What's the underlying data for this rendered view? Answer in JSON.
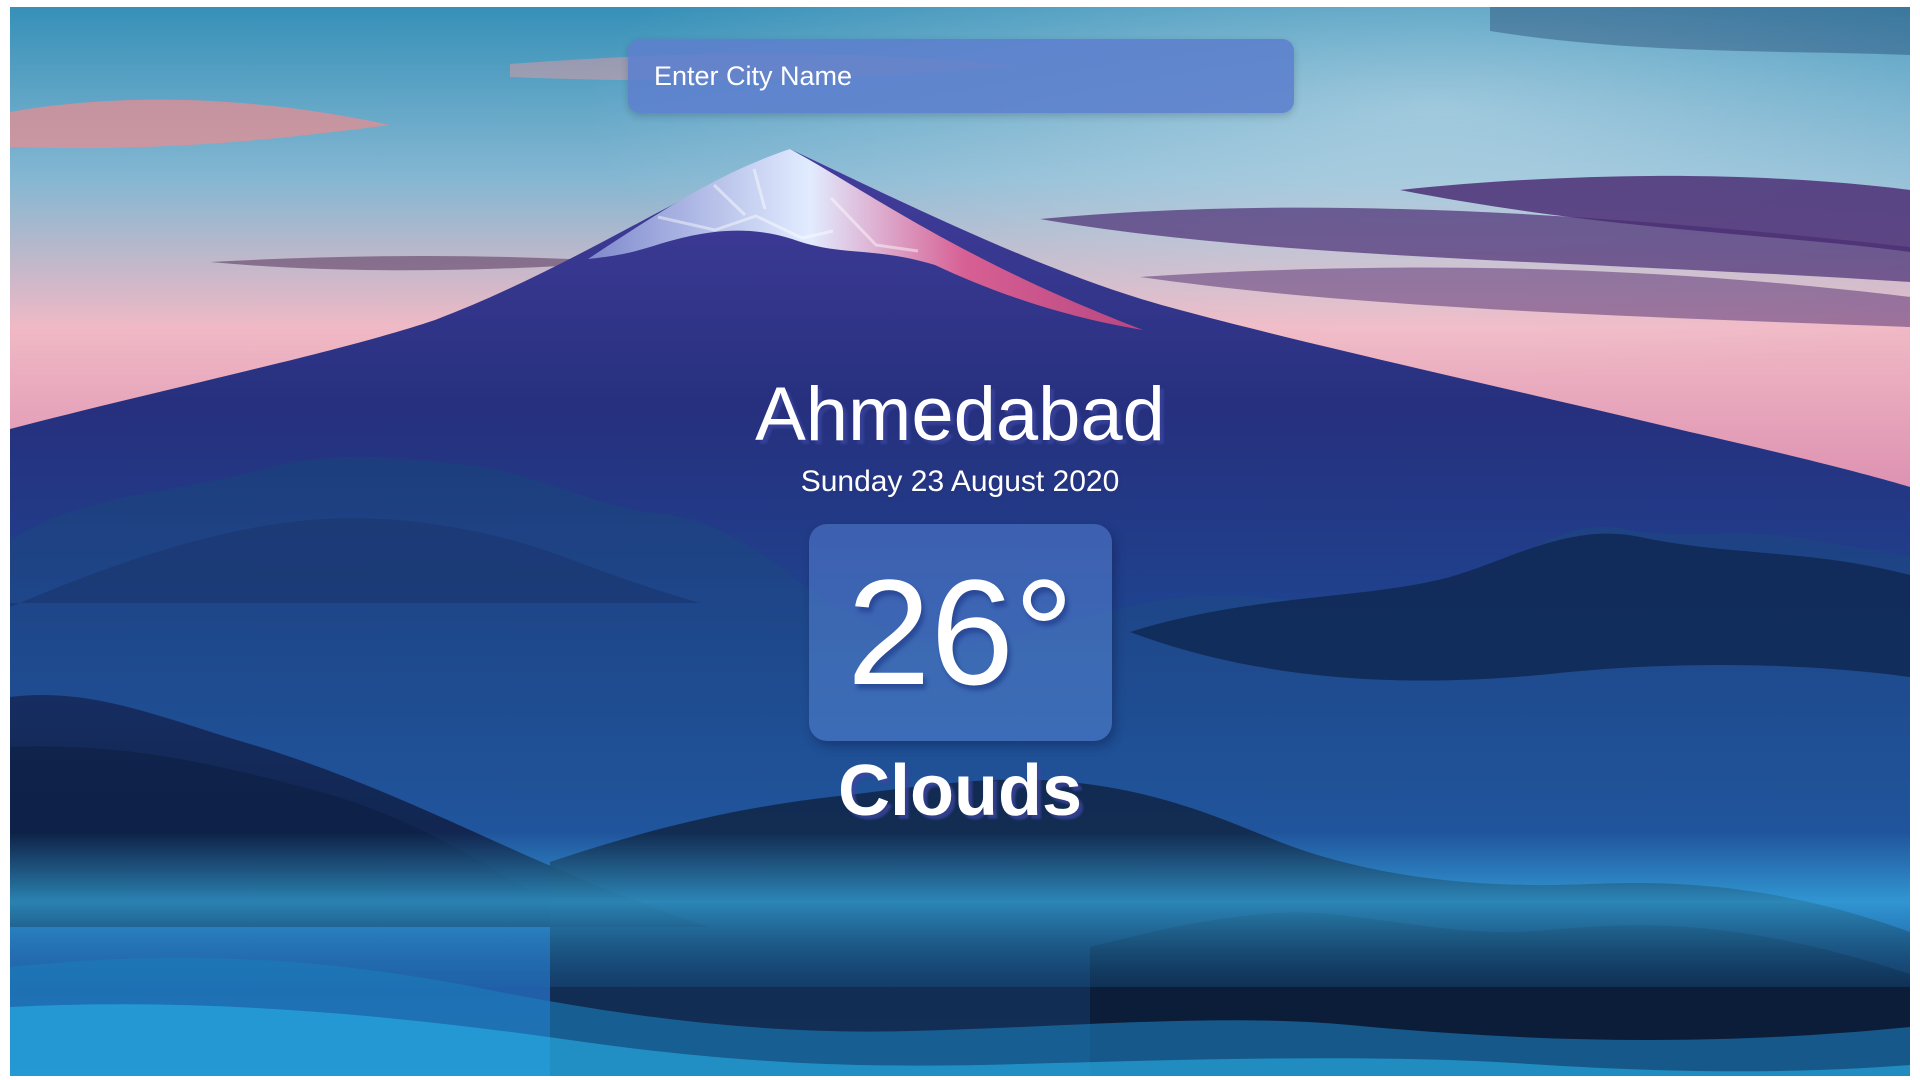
{
  "search": {
    "placeholder": "Enter City Name"
  },
  "location": {
    "city": "Ahmedabad",
    "date": "Sunday 23 August 2020"
  },
  "weather": {
    "temperature": "26°",
    "condition": "Clouds"
  },
  "colors": {
    "sky_top": "#3f92b7",
    "sky_pink": "#f0a6b5",
    "mountain_red": "#e25a8d",
    "mountain_blue": "#1c3d83",
    "foreground_dark": "#102449",
    "mist": "#2aa2d7",
    "search_background": "#5c80cd",
    "temperature_box": "#6496e6"
  }
}
